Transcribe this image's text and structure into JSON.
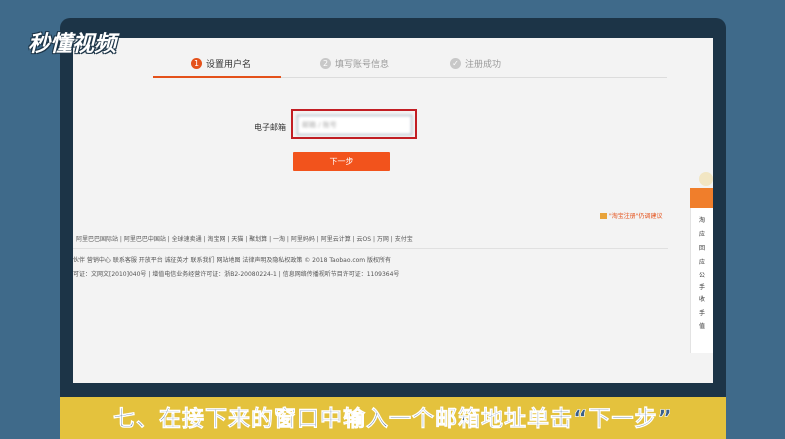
{
  "watermark": "秒懂视频",
  "steps": [
    {
      "num": "1",
      "label": "设置用户名"
    },
    {
      "num": "2",
      "label": "填写账号信息"
    },
    {
      "num": "✓",
      "label": "注册成功"
    }
  ],
  "form": {
    "email_label": "电子邮箱",
    "email_value": "邮箱 / 账号",
    "next_label": "下一步"
  },
  "suggest_link": "\"淘宝注册\"仍调建议",
  "footer": {
    "links": "阿里巴巴国际站 | 阿里巴巴中国站 | 全球速卖通 | 淘宝网 | 天猫 | 聚划算 | 一淘 | 阿里妈妈 | 阿里云计算 | 云OS | 万网 | 支付宝",
    "links2": "伙伴   营销中心  联系客服  开放平台  诚征英才  联系我们  网站地图  法律声明及隐私权政策        © 2018 Taobao.com 版权所有",
    "license": "可证：文网文[2010]040号  |  增值电信业务经营许可证：浙B2-20080224-1  |  信息网络传播视听节目许可证：1109364号"
  },
  "side_items": [
    "淘",
    "应",
    "回",
    "应",
    "公",
    "手",
    "收",
    "手",
    "值"
  ],
  "caption": "七、在接下来的窗口中输入一个邮箱地址单击“下一步”"
}
